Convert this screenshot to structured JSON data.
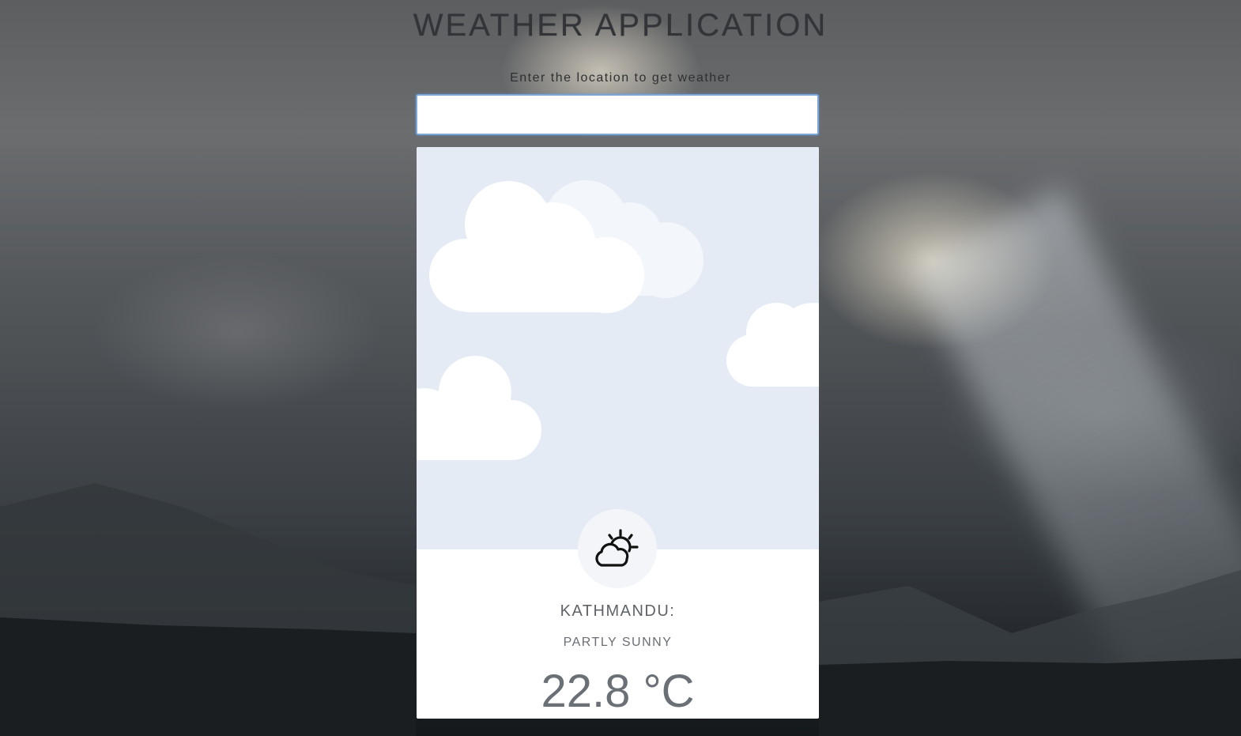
{
  "app": {
    "title": "WEATHER APPLICATION"
  },
  "search": {
    "prompt": "Enter the location to get weather",
    "value": "",
    "placeholder": ""
  },
  "weather": {
    "city": "KATHMANDU:",
    "condition": "PARTLY SUNNY",
    "temperature": "22.8 °C",
    "icon": "partly-sunny-icon"
  },
  "colors": {
    "card_sky": "#e4ebf5",
    "card_body": "#ffffff",
    "input_focus_border": "#7aa7d8",
    "title_text": "#333438"
  }
}
